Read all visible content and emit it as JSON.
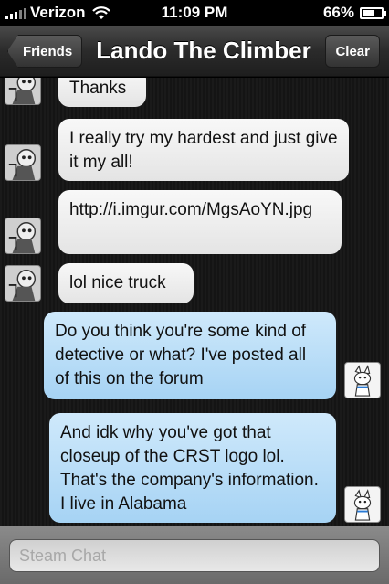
{
  "status_bar": {
    "carrier": "Verizon",
    "time": "11:09 PM",
    "battery_percent": "66%",
    "battery_level": 0.66,
    "signal_icon": "signal-bars-icon",
    "wifi_icon": "wifi-icon",
    "battery_icon": "battery-icon"
  },
  "nav": {
    "back_label": "Friends",
    "title": "Lando The Climber",
    "clear_label": "Clear"
  },
  "messages": [
    {
      "sender": "friend",
      "text": "Thanks"
    },
    {
      "sender": "friend",
      "text": "I really try my hardest and just give it my all!"
    },
    {
      "sender": "friend",
      "text": "http://i.imgur.com/MgsAoYN.jpg"
    },
    {
      "sender": "friend",
      "text": "lol nice truck"
    },
    {
      "sender": "me",
      "text": "Do you think you're some kind of detective or what? I've posted all of this on the forum"
    },
    {
      "sender": "me",
      "text": "And idk why you've got that closeup of the CRST logo lol. That's the company's information. I live in Alabama"
    }
  ],
  "input": {
    "placeholder": "Steam Chat",
    "value": ""
  },
  "colors": {
    "incoming_bubble": "#eeeeee",
    "outgoing_bubble": "#b8dcf6",
    "nav_bar": "#2b2b2b",
    "background": "#161616"
  }
}
